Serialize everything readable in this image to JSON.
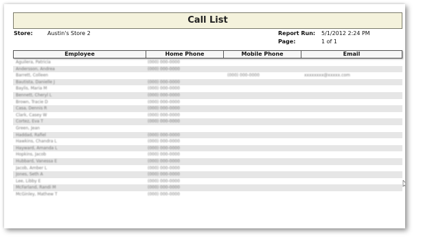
{
  "report": {
    "title": "Call List",
    "store_label": "Store:",
    "store_value": "Austin's Store 2",
    "run_label": "Report Run:",
    "run_value": "5/1/2012 2:24 PM",
    "page_label": "Page:",
    "page_value": "1 of 1"
  },
  "table": {
    "columns": [
      "Employee",
      "Home Phone",
      "Mobile Phone",
      "Email"
    ],
    "rows": [
      [
        "Aguilera, Patricia",
        "(000) 000-0000",
        "",
        ""
      ],
      [
        "Andersson, Andrea",
        "(000) 000-0000",
        "",
        ""
      ],
      [
        "Barrett, Colleen",
        "",
        "(000) 000-0000",
        "xxxxxxxx@xxxxx.com"
      ],
      [
        "Bautista, Danielle J",
        "(000) 000-0000",
        "",
        ""
      ],
      [
        "Baylis, Maria M",
        "(000) 000-0000",
        "",
        ""
      ],
      [
        "Bennett, Cheryl L",
        "(000) 000-0000",
        "",
        ""
      ],
      [
        "Brown, Tracie D",
        "(000) 000-0000",
        "",
        ""
      ],
      [
        "Casa, Dennis R",
        "(000) 000-0000",
        "",
        ""
      ],
      [
        "Clark, Casey W",
        "(000) 000-0000",
        "",
        ""
      ],
      [
        "Cortez, Eva T",
        "(000) 000-0000",
        "",
        ""
      ],
      [
        "Green, Jean",
        "",
        "",
        ""
      ],
      [
        "Haddad, Rafiel",
        "(000) 000-0000",
        "",
        ""
      ],
      [
        "Hawkins, Chandra L",
        "(000) 000-0000",
        "",
        ""
      ],
      [
        "Hayward, Amanda L",
        "(000) 000-0000",
        "",
        ""
      ],
      [
        "Hopkins, Jacob",
        "(000) 000-0000",
        "",
        ""
      ],
      [
        "Hubbard, Vanessa E",
        "(000) 000-0000",
        "",
        ""
      ],
      [
        "Jacob, Amber L",
        "(000) 000-0000",
        "",
        ""
      ],
      [
        "Jones, Seth A",
        "(000) 000-0000",
        "",
        ""
      ],
      [
        "Lee, Libby E",
        "(000) 000-0000",
        "",
        ""
      ],
      [
        "McFarland, Randi M",
        "(000) 000-0000",
        "",
        ""
      ],
      [
        "McGinley, Mathew T",
        "(000) 000-0000",
        "",
        ""
      ]
    ]
  }
}
